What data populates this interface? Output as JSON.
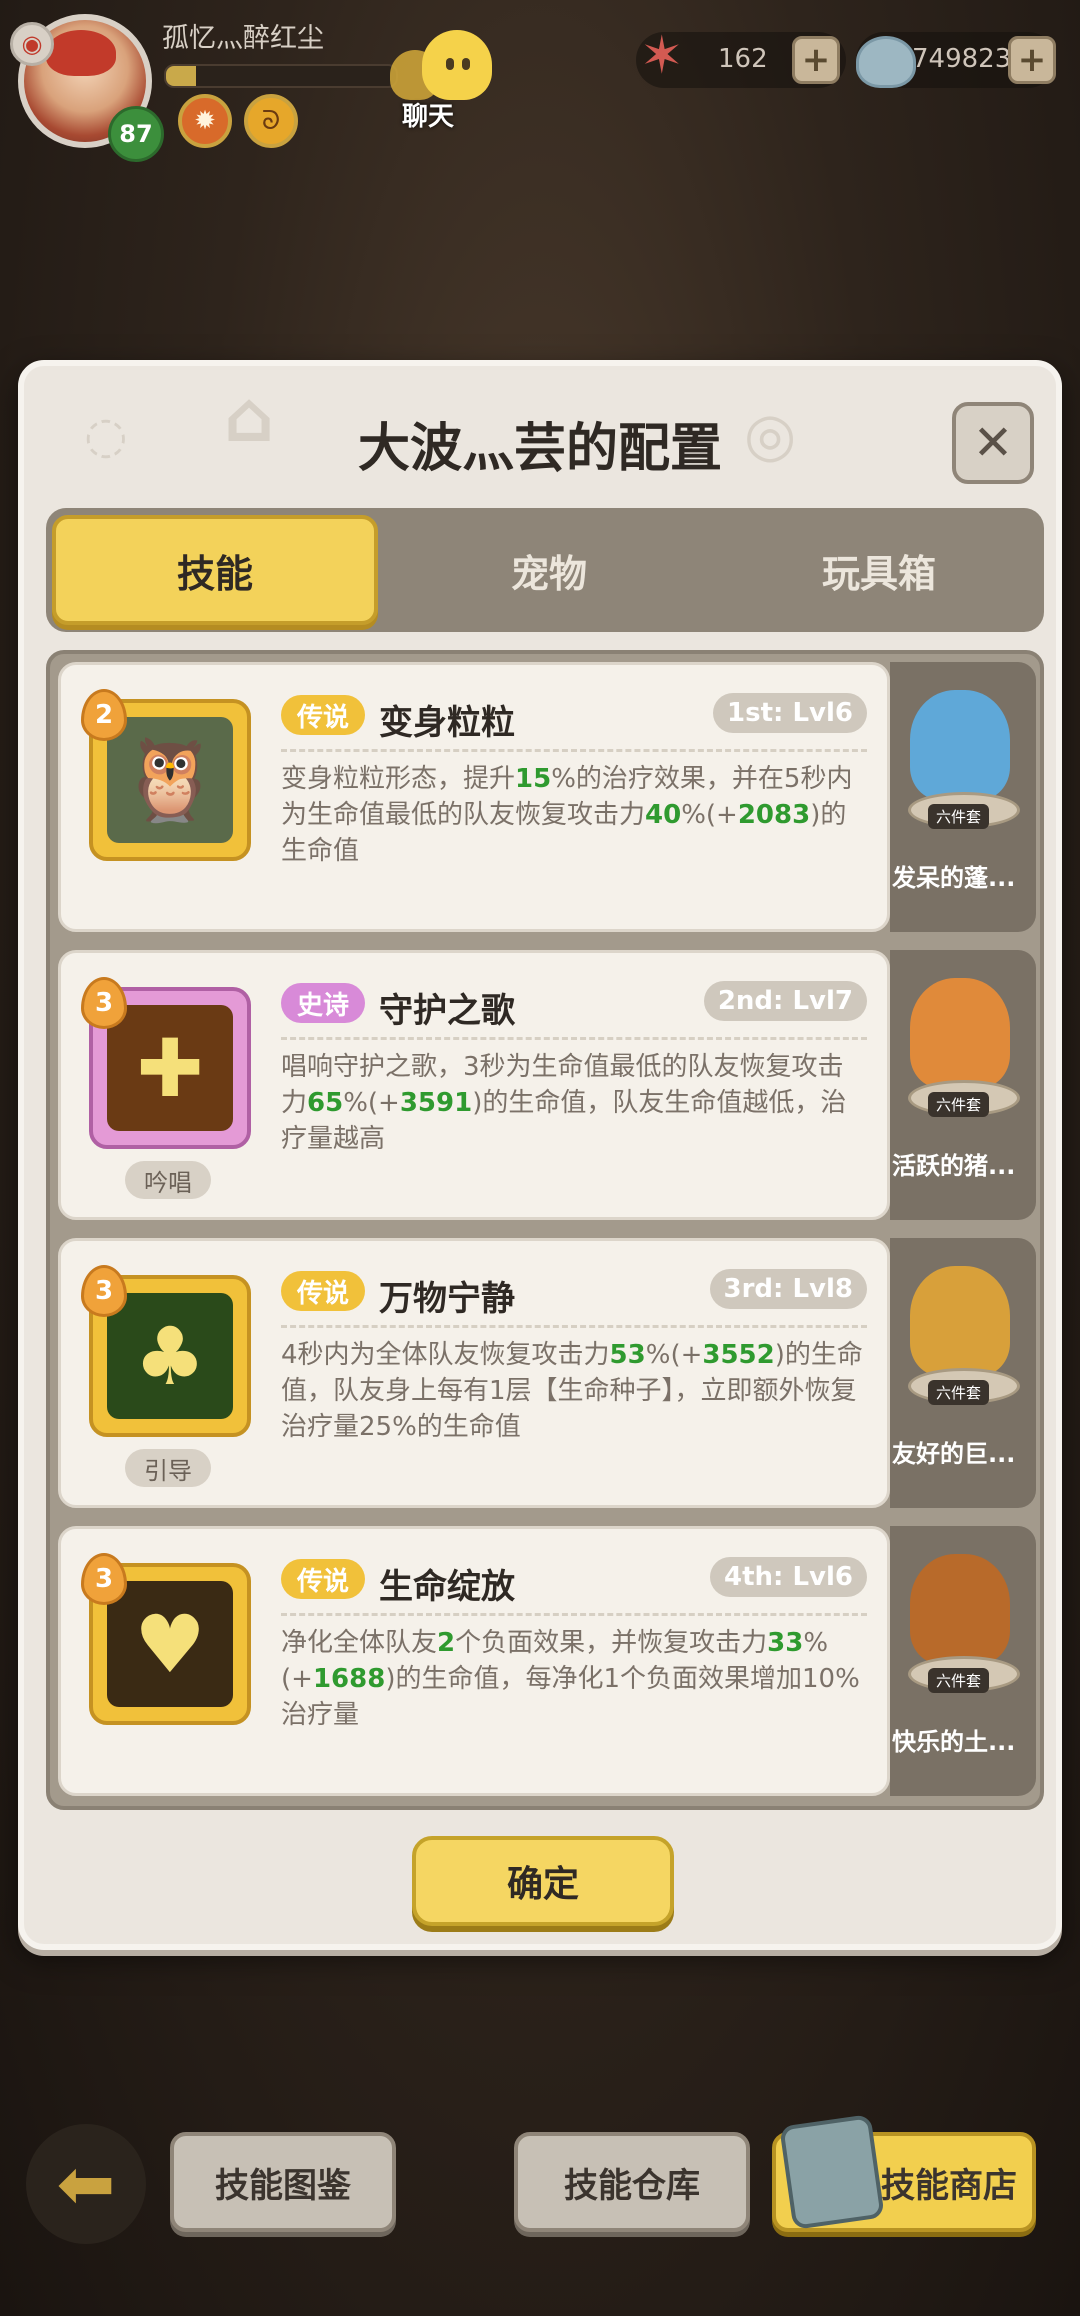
{
  "player": {
    "name": "孤忆灬醉红尘",
    "level": "87",
    "exp_fraction": 0.13
  },
  "chat": {
    "label": "聊天"
  },
  "currency": {
    "starfish": "162",
    "shells": "749823"
  },
  "dialog": {
    "title": "大波灬芸的配置",
    "close_icon": "close-icon",
    "tabs": [
      {
        "label": "技能",
        "active": true
      },
      {
        "label": "宠物",
        "active": false
      },
      {
        "label": "玩具箱",
        "active": false
      }
    ],
    "skills": [
      {
        "rarity": "传说",
        "rarity_type": "legend",
        "name": "变身粒粒",
        "level_drop": "2",
        "slot": "1st: Lvl6",
        "cast_tag": "",
        "desc": [
          {
            "t": "变身粒粒形态，提升"
          },
          {
            "t": "15",
            "g": true
          },
          {
            "t": "%的治疗效果，并在5秒内为生命值最低的队友恢复攻击力"
          },
          {
            "t": "40",
            "g": true
          },
          {
            "t": "%(+"
          },
          {
            "t": "2083",
            "g": true
          },
          {
            "t": ")的生命值"
          }
        ],
        "pet": {
          "name": "发呆的蓬...",
          "set": "六件套",
          "color": "#5fa8d8"
        }
      },
      {
        "rarity": "史诗",
        "rarity_type": "epic",
        "name": "守护之歌",
        "level_drop": "3",
        "slot": "2nd: Lvl7",
        "cast_tag": "吟唱",
        "desc": [
          {
            "t": "唱响守护之歌，3秒为生命值最低的队友恢复攻击力"
          },
          {
            "t": "65",
            "g": true
          },
          {
            "t": "%(+"
          },
          {
            "t": "3591",
            "g": true
          },
          {
            "t": ")的生命值，队友生命值越低，治疗量越高"
          }
        ],
        "pet": {
          "name": "活跃的猪...",
          "set": "六件套",
          "color": "#e08a3a"
        }
      },
      {
        "rarity": "传说",
        "rarity_type": "legend",
        "name": "万物宁静",
        "level_drop": "3",
        "slot": "3rd: Lvl8",
        "cast_tag": "引导",
        "desc": [
          {
            "t": "4秒内为全体队友恢复攻击力"
          },
          {
            "t": "53",
            "g": true
          },
          {
            "t": "%(+"
          },
          {
            "t": "3552",
            "g": true
          },
          {
            "t": ")的生命值，队友身上每有1层【生命种子】，立即额外恢复治疗量25%的生命值"
          }
        ],
        "pet": {
          "name": "友好的巨...",
          "set": "六件套",
          "color": "#d8a03a"
        }
      },
      {
        "rarity": "传说",
        "rarity_type": "legend",
        "name": "生命绽放",
        "level_drop": "3",
        "slot": "4th: Lvl6",
        "cast_tag": "",
        "desc": [
          {
            "t": "净化全体队友"
          },
          {
            "t": "2",
            "g": true
          },
          {
            "t": "个负面效果，并恢复攻击力"
          },
          {
            "t": "33",
            "g": true
          },
          {
            "t": "%(+"
          },
          {
            "t": "1688",
            "g": true
          },
          {
            "t": ")的生命值，每净化1个负面效果增加10%治疗量"
          }
        ],
        "pet": {
          "name": "快乐的土...",
          "set": "六件套",
          "color": "#b86a2a"
        }
      }
    ],
    "confirm": "确定"
  },
  "bottom": {
    "back_icon": "back-arrow-icon",
    "skill_codex": "技能图鉴",
    "skill_storage": "技能仓库",
    "skill_shop": "技能商店"
  }
}
